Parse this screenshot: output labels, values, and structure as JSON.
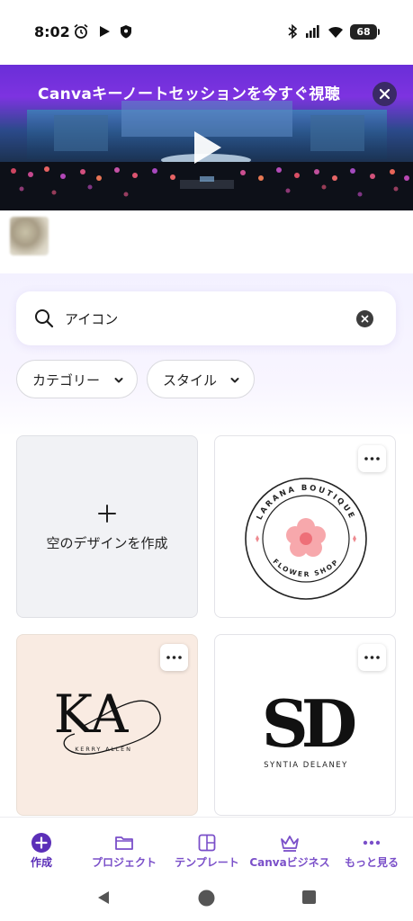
{
  "status_bar": {
    "time": "8:02",
    "battery": "68",
    "icons": [
      "alarm-icon",
      "play-store-icon",
      "shield-icon",
      "bluetooth-icon",
      "signal-icon",
      "wifi-icon"
    ]
  },
  "banner": {
    "title": "Canvaキーノートセッションを今すぐ視聴",
    "close_icon": "close-icon",
    "play_icon": "play-icon"
  },
  "search": {
    "value": "アイコン",
    "placeholder": "アイコン"
  },
  "filters": [
    {
      "label": "カテゴリー"
    },
    {
      "label": "スタイル"
    }
  ],
  "cards": {
    "blank": {
      "label": "空のデザインを作成"
    },
    "template_1": {
      "top_text": "LARANA BOUTIQUE",
      "bottom_text": "FLOWER SHOP"
    },
    "template_2": {
      "monogram": "KA",
      "caption": "KERRY ALLEN"
    },
    "template_3": {
      "monogram": "SD",
      "caption": "SYNTIA DELANEY"
    }
  },
  "bottom_nav": [
    {
      "label": "作成",
      "icon": "plus-circle-icon",
      "active": true
    },
    {
      "label": "プロジェクト",
      "icon": "folder-icon",
      "active": false
    },
    {
      "label": "テンプレート",
      "icon": "template-icon",
      "active": false
    },
    {
      "label": "Canvaビジネス",
      "icon": "crown-icon",
      "active": false
    },
    {
      "label": "もっと見る",
      "icon": "more-dots-icon",
      "active": false
    }
  ],
  "colors": {
    "accent": "#7a4fc9",
    "active_nav": "#5b2fb8",
    "banner_purple": "#7d33e0",
    "flower_pink": "#f7a8ac"
  }
}
